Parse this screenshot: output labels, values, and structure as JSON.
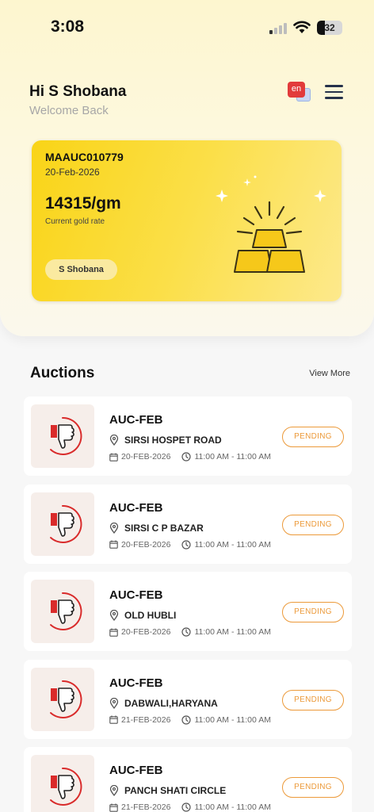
{
  "status_bar": {
    "time": "3:08",
    "battery": "32",
    "battery_level": 0.32
  },
  "header": {
    "greeting": "Hi S Shobana",
    "subtitle": "Welcome Back",
    "language_badge": "en",
    "icons": [
      "language-icon",
      "menu-icon"
    ]
  },
  "gold_card": {
    "code": "MAAUC010779",
    "date": "20-Feb-2026",
    "rate": "14315/gm",
    "rate_label": "Current gold rate",
    "name": "S Shobana",
    "icon": "gold-bars-icon"
  },
  "auctions": {
    "heading": "Auctions",
    "view_more": "View More",
    "items": [
      {
        "title": "AUC-FEB",
        "location": "SIRSI HOSPET ROAD",
        "date": "20-FEB-2026",
        "time": "11:00 AM - 11:00 AM",
        "status": "PENDING"
      },
      {
        "title": "AUC-FEB",
        "location": "SIRSI C P BAZAR",
        "date": "20-FEB-2026",
        "time": "11:00 AM - 11:00 AM",
        "status": "PENDING"
      },
      {
        "title": "AUC-FEB",
        "location": "OLD HUBLI",
        "date": "20-FEB-2026",
        "time": "11:00 AM - 11:00 AM",
        "status": "PENDING"
      },
      {
        "title": "AUC-FEB",
        "location": "DABWALI,HARYANA",
        "date": "21-FEB-2026",
        "time": "11:00 AM - 11:00 AM",
        "status": "PENDING"
      },
      {
        "title": "AUC-FEB",
        "location": "PANCH SHATI CIRCLE",
        "date": "21-FEB-2026",
        "time": "11:00 AM - 11:00 AM",
        "status": "PENDING"
      }
    ]
  },
  "colors": {
    "accent_gold": "#f9d417",
    "pending": "#ec9a3a",
    "thumbs_down": "#d92b2b"
  }
}
